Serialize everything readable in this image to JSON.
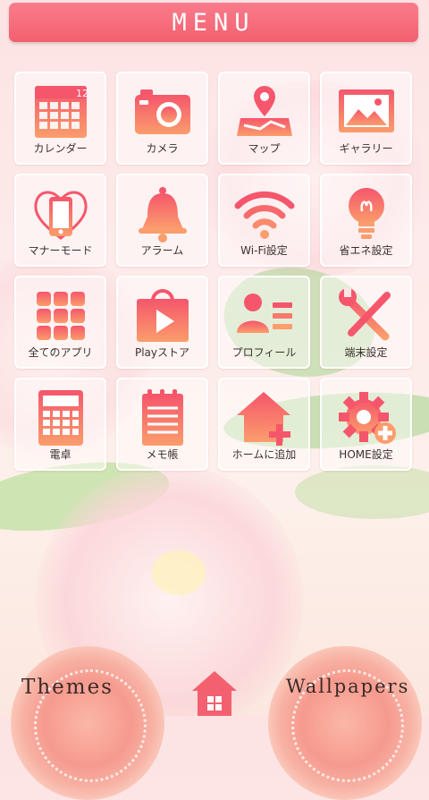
{
  "header": {
    "title": "MENU"
  },
  "accent": "#f36d7d",
  "grid": [
    {
      "label": "カレンダー",
      "icon": "calendar-icon",
      "badge": "12"
    },
    {
      "label": "カメラ",
      "icon": "camera-icon"
    },
    {
      "label": "マップ",
      "icon": "map-icon"
    },
    {
      "label": "ギャラリー",
      "icon": "gallery-icon"
    },
    {
      "label": "マナーモード",
      "icon": "manner-mode-icon"
    },
    {
      "label": "アラーム",
      "icon": "alarm-bell-icon"
    },
    {
      "label": "Wi-Fi設定",
      "icon": "wifi-icon"
    },
    {
      "label": "省エネ設定",
      "icon": "lightbulb-icon"
    },
    {
      "label": "全てのアプリ",
      "icon": "all-apps-icon"
    },
    {
      "label": "Playストア",
      "icon": "play-store-icon"
    },
    {
      "label": "プロフィール",
      "icon": "profile-icon"
    },
    {
      "label": "端末設定",
      "icon": "tools-icon"
    },
    {
      "label": "電卓",
      "icon": "calculator-icon"
    },
    {
      "label": "メモ帳",
      "icon": "notepad-icon"
    },
    {
      "label": "ホームに追加",
      "icon": "add-home-icon"
    },
    {
      "label": "HOME設定",
      "icon": "home-settings-gear-icon"
    }
  ],
  "bottom": {
    "themes_label": "Themes",
    "wallpapers_label": "Wallpapers",
    "home_icon": "home-icon"
  }
}
